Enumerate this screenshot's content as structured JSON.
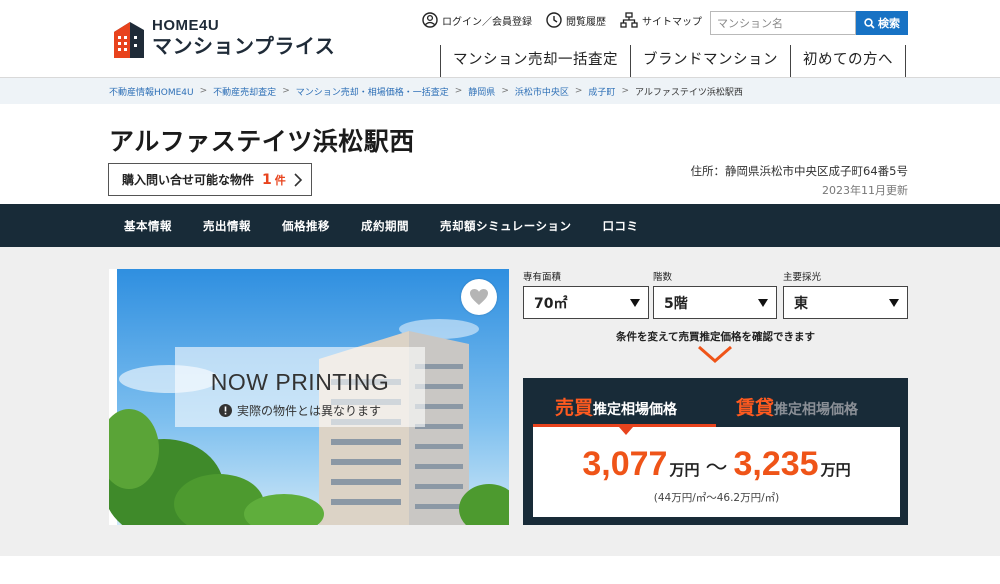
{
  "logo": {
    "top": "HOME4U",
    "bottom": "マンションプライス"
  },
  "util": {
    "login": "ログイン／会員登録",
    "history": "閲覧履歴",
    "sitemap": "サイトマップ"
  },
  "search": {
    "placeholder": "マンション名",
    "button": "検索"
  },
  "gnav": [
    "マンション売却一括査定",
    "ブランドマンション",
    "初めての方へ"
  ],
  "breadcrumb": [
    "不動産情報HOME4U",
    "不動産売却査定",
    "マンション売却・相場価格・一括査定",
    "静岡県",
    "浜松市中央区",
    "成子町",
    "アルファステイツ浜松駅西"
  ],
  "property": {
    "title": "アルファステイツ浜松駅西",
    "inquiry_label": "購入問い合せ可能な物件",
    "inquiry_count": "1",
    "inquiry_unit": "件",
    "address": "住所：静岡県浜松市中央区成子町64番5号",
    "updated": "2023年11月更新"
  },
  "tabs": [
    "基本情報",
    "売出情報",
    "価格推移",
    "成約期間",
    "売却額シミュレーション",
    "口コミ"
  ],
  "photo": {
    "title": "NOW PRINTING",
    "subtitle": "実際の物件とは異なります"
  },
  "selectors": {
    "area": {
      "label": "専有面積",
      "value": "70㎡"
    },
    "floor": {
      "label": "階数",
      "value": "5階"
    },
    "direction": {
      "label": "主要採光",
      "value": "東"
    }
  },
  "hint": "条件を変えて売買推定価格を確認できます",
  "price": {
    "tab_sale_big": "売買",
    "tab_sale_rest": "推定相場価格",
    "tab_rent_big": "賃貸",
    "tab_rent_rest": "推定相場価格",
    "low": "3,077",
    "high": "3,235",
    "unit": "万円",
    "tilde": "～",
    "per_sqm": "(44万円/㎡～46.2万円/㎡)"
  },
  "colors": {
    "accent": "#ef5418",
    "navy": "#182b38",
    "link": "#2f70b7",
    "search_button": "#1772c4"
  }
}
